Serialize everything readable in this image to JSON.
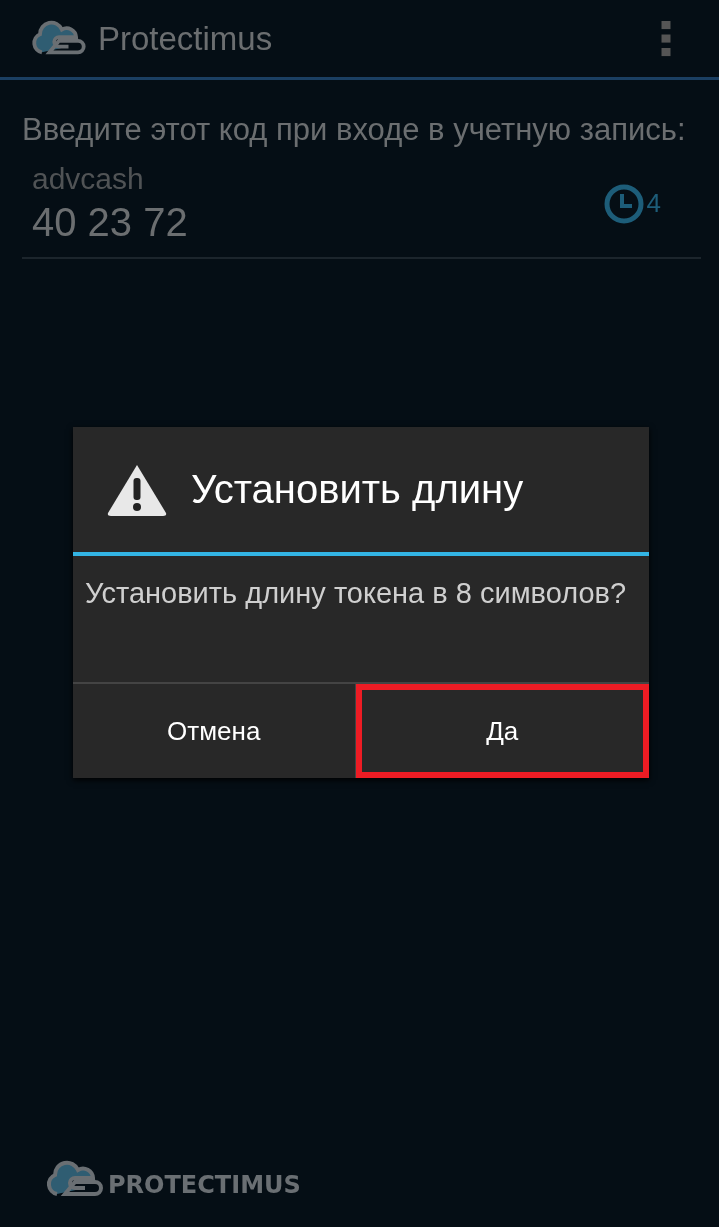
{
  "app_bar": {
    "title": "Protectimus"
  },
  "instruction": "Введите этот код при входе в учетную запись:",
  "tokens": [
    {
      "name": "advcash",
      "code": "40 23 72",
      "seconds": "4"
    }
  ],
  "dialog": {
    "title": "Установить длину",
    "message": "Установить длину токена в 8 символов?",
    "buttons": [
      {
        "label": "Отмена",
        "highlighted": false
      },
      {
        "label": "Да",
        "highlighted": true
      }
    ]
  },
  "footer": {
    "logo_text": "PROTECTIMUS"
  }
}
